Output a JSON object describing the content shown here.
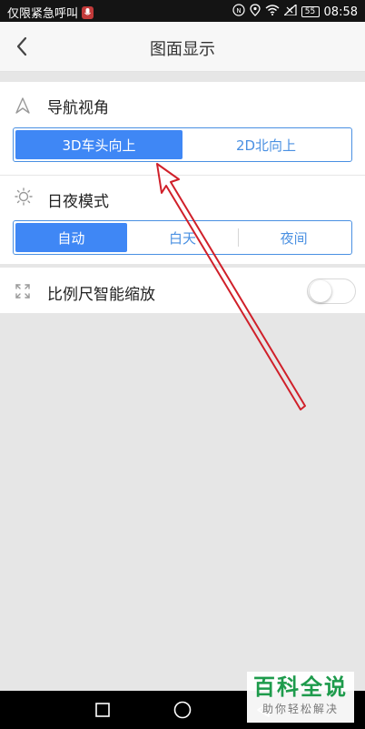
{
  "status_bar": {
    "carrier": "仅限紧急呼叫",
    "battery": "55",
    "time": "08:58",
    "icons": [
      "mic-muted-icon",
      "hd-icon",
      "location-icon",
      "wifi-icon",
      "signal-icon",
      "battery-icon"
    ]
  },
  "header": {
    "title": "图面显示",
    "back_icon": "chevron-left-icon"
  },
  "nav_view": {
    "label": "导航视角",
    "icon": "navigation-arrow-icon",
    "options": [
      "3D车头向上",
      "2D北向上"
    ],
    "selected": "3D车头向上"
  },
  "day_night": {
    "label": "日夜模式",
    "icon": "sun-icon",
    "options": [
      "自动",
      "白天",
      "夜间"
    ],
    "selected": "自动"
  },
  "smart_scale": {
    "label": "比例尺智能缩放",
    "icon": "expand-icon",
    "enabled": false
  },
  "watermark": {
    "main": "百科全说",
    "sub": "助你轻松解决"
  },
  "nav_bar": {
    "icons": [
      "recent-apps-icon",
      "home-circle-icon",
      "back-triangle-icon"
    ]
  },
  "colors": {
    "accent": "#3f87f5",
    "annotation_arrow": "#d0202a",
    "watermark_green": "#1e9b4c"
  }
}
